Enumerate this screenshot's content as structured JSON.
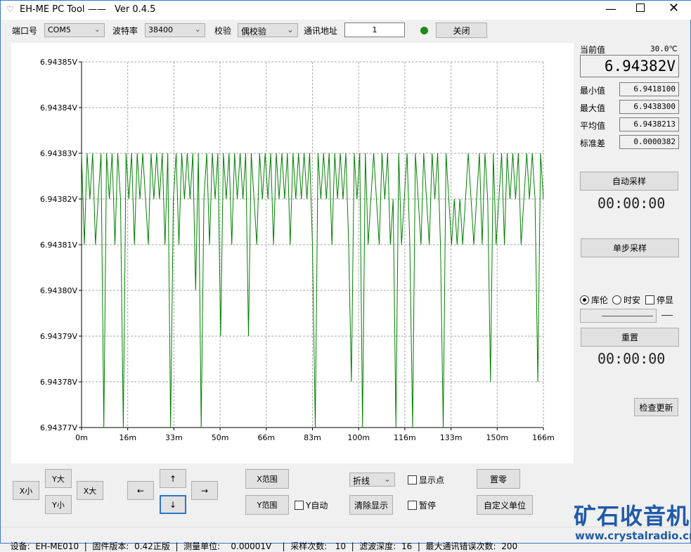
{
  "window": {
    "title": "EH-ME PC Tool",
    "separator": "——",
    "version": "Ver 0.4.5"
  },
  "toolbar": {
    "port_label": "端口号",
    "port_value": "COM5",
    "baud_label": "波特率",
    "baud_value": "38400",
    "parity_label": "校验",
    "parity_value": "偶校验",
    "addr_label": "通讯地址",
    "addr_value": "1",
    "status_color": "#1a8a1a",
    "close_label": "关闭"
  },
  "right": {
    "current_label": "当前值",
    "temperature": "30.0℃",
    "current_value": "6.94382V",
    "stats": [
      {
        "label": "最小值",
        "value": "6.9418100"
      },
      {
        "label": "最大值",
        "value": "6.9438300"
      },
      {
        "label": "平均值",
        "value": "6.9438213"
      },
      {
        "label": "标准差",
        "value": "0.0000382"
      }
    ],
    "auto_sample": "自动采样",
    "timer1": "00:00:00",
    "single_sample": "单步采样",
    "radio_coulomb": "库伦",
    "radio_hour": "时安",
    "chk_stop": "停显",
    "reset": "重置",
    "timer2": "00:00:00",
    "check_update": "检查更新"
  },
  "controls": {
    "x_small": "X小",
    "y_big": "Y大",
    "y_small": "Y小",
    "x_big": "X大",
    "left": "←",
    "up": "↑",
    "down": "↓",
    "right": "→",
    "x_range": "X范围",
    "y_range": "Y范围",
    "y_auto": "Y自动",
    "mode": "折线",
    "show_points": "显示点",
    "clear": "清除显示",
    "pause": "暂停",
    "zero": "置零",
    "custom_unit": "自定义单位"
  },
  "logo": {
    "name": "矿石收音机",
    "url": "www.crystalradio.cn",
    "color": "#1f5aa8"
  },
  "status": {
    "device": "设备:  EH-ME010",
    "firmware": "固件版本:  0.42正版",
    "unit": "测量单位:    0.00001V",
    "samples": "采样次数:   10",
    "filter": "滤波深度:  16",
    "max_err": "最大通讯错误次数:  200"
  },
  "chart_data": {
    "type": "line",
    "color": "#008000",
    "grid": true,
    "xlim": [
      0,
      166
    ],
    "ylim": [
      6.94377,
      6.94385
    ],
    "x_ticks": [
      "0m",
      "16m",
      "33m",
      "50m",
      "66m",
      "83m",
      "100m",
      "116m",
      "133m",
      "150m",
      "166m"
    ],
    "y_ticks": [
      "6.94385V",
      "6.94384V",
      "6.94383V",
      "6.94382V",
      "6.94381V",
      "6.94380V",
      "6.94379V",
      "6.94378V",
      "6.94377V"
    ],
    "x_unit": "min",
    "y": [
      6.94383,
      6.94381,
      6.94383,
      6.94382,
      6.94383,
      6.94381,
      6.94382,
      6.94383,
      6.94377,
      6.94383,
      6.94382,
      6.94383,
      6.94381,
      6.94383,
      6.94382,
      6.94377,
      6.94383,
      6.94382,
      6.94383,
      6.94381,
      6.94383,
      6.94382,
      6.94383,
      6.94382,
      6.94381,
      6.94383,
      6.94382,
      6.94383,
      6.94382,
      6.94383,
      6.94381,
      6.94383,
      6.94377,
      6.94382,
      6.94383,
      6.94381,
      6.94383,
      6.94382,
      6.94383,
      6.94382,
      6.94383,
      6.9438,
      6.94383,
      6.94377,
      6.94382,
      6.94383,
      6.94381,
      6.94383,
      6.94382,
      6.94383,
      6.94379,
      6.94383,
      6.94382,
      6.94383,
      6.94381,
      6.94383,
      6.94382,
      6.94383,
      6.94382,
      6.94383,
      6.94379,
      6.94383,
      6.94382,
      6.94381,
      6.94383,
      6.94382,
      6.94383,
      6.94382,
      6.94383,
      6.94381,
      6.94383,
      6.94382,
      6.94383,
      6.94382,
      6.94383,
      6.94381,
      6.94383,
      6.94382,
      6.94383,
      6.94382,
      6.94383,
      6.94382,
      6.94383,
      6.94381,
      6.94377,
      6.94383,
      6.94382,
      6.94383,
      6.94382,
      6.94383,
      6.94381,
      6.94383,
      6.94382,
      6.94383,
      6.94382,
      6.94383,
      6.94381,
      6.94378,
      6.94383,
      6.94382,
      6.94383,
      6.94377,
      6.94383,
      6.94381,
      6.94382,
      6.94383,
      6.94382,
      6.94381,
      6.94383,
      6.94382,
      6.94383,
      6.94381,
      6.94382,
      6.94377,
      6.94383,
      6.94381,
      6.94382,
      6.94383,
      6.94381,
      6.94377,
      6.94383,
      6.94382,
      6.94381,
      6.94383,
      6.94382,
      6.94381,
      6.94383,
      6.94382,
      6.94383,
      6.94381,
      6.94377,
      6.94383,
      6.94382,
      6.94381,
      6.94382,
      6.94381,
      6.94382,
      6.94381,
      6.94382,
      6.94383,
      6.94382,
      6.94381,
      6.94382,
      6.94383,
      6.94381,
      6.94383,
      6.94382,
      6.94378,
      6.94383,
      6.94381,
      6.94382,
      6.94383,
      6.94381,
      6.94383,
      6.94382,
      6.94383,
      6.94382,
      6.94383,
      6.94381,
      6.94382,
      6.94383,
      6.94382,
      6.94383,
      6.94382,
      6.94378,
      6.94383,
      6.94382
    ]
  }
}
